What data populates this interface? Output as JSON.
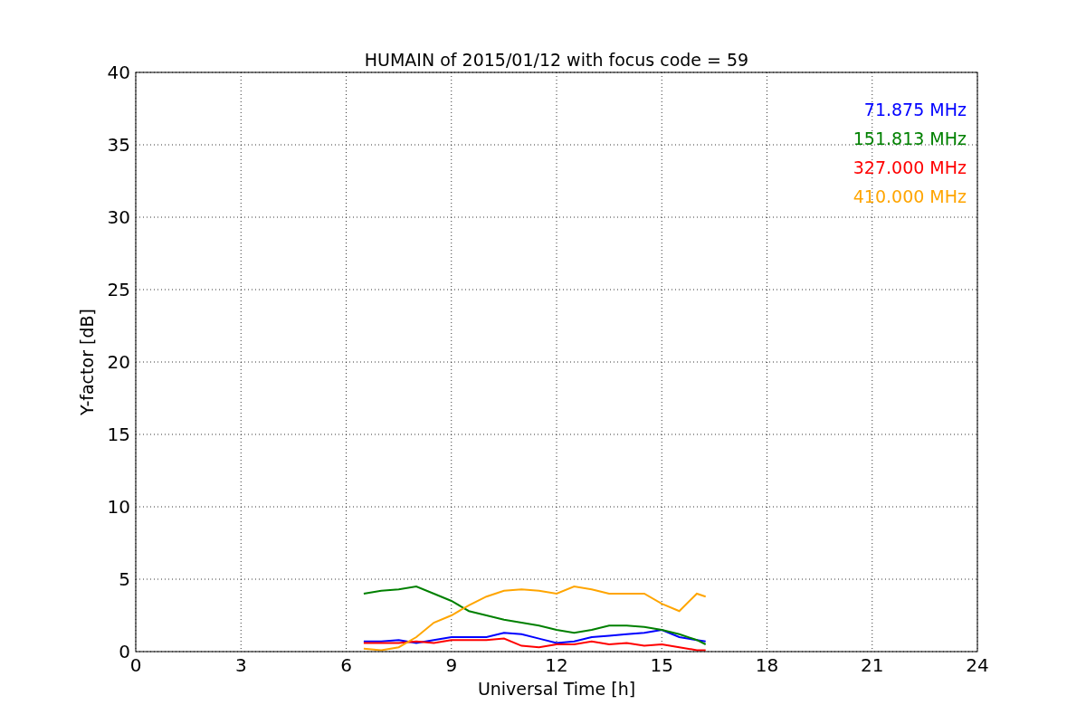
{
  "chart": {
    "chart_data": {
      "type": "line",
      "title": "HUMAIN of 2015/01/12 with focus code = 59",
      "xlabel": "Universal Time [h]",
      "ylabel": "Y-factor [dB]",
      "xlim": [
        0,
        24
      ],
      "ylim": [
        0,
        40
      ],
      "xticks": [
        0,
        3,
        6,
        9,
        12,
        15,
        18,
        21,
        24
      ],
      "yticks": [
        0,
        5,
        10,
        15,
        20,
        25,
        30,
        35,
        40
      ],
      "grid": true,
      "x": [
        6.5,
        7,
        7.5,
        8,
        8.5,
        9,
        9.5,
        10,
        10.5,
        11,
        11.5,
        12,
        12.5,
        13,
        13.5,
        14,
        14.5,
        15,
        15.5,
        16,
        16.25
      ],
      "series": [
        {
          "name": "71.875 MHz",
          "color": "#0000ff",
          "values": [
            0.7,
            0.7,
            0.8,
            0.6,
            0.8,
            1,
            1,
            1,
            1.3,
            1.2,
            0.9,
            0.6,
            0.7,
            1,
            1.1,
            1.2,
            1.3,
            1.5,
            1,
            0.8,
            0.7
          ]
        },
        {
          "name": "151.813 MHz",
          "color": "#008000",
          "values": [
            4,
            4.2,
            4.3,
            4.5,
            4,
            3.5,
            2.8,
            2.5,
            2.2,
            2,
            1.8,
            1.5,
            1.3,
            1.5,
            1.8,
            1.8,
            1.7,
            1.5,
            1.2,
            0.8,
            0.5
          ]
        },
        {
          "name": "327.000 MHz",
          "color": "#ff0000",
          "values": [
            0.6,
            0.6,
            0.6,
            0.7,
            0.6,
            0.8,
            0.8,
            0.8,
            0.9,
            0.4,
            0.3,
            0.5,
            0.5,
            0.7,
            0.5,
            0.6,
            0.4,
            0.5,
            0.3,
            0.1,
            0.1
          ]
        },
        {
          "name": "410.000 MHz",
          "color": "#ffa500",
          "values": [
            0.2,
            0.1,
            0.3,
            1,
            2,
            2.5,
            3.2,
            3.8,
            4.2,
            4.3,
            4.2,
            4,
            4.5,
            4.3,
            4,
            4,
            4,
            3.3,
            2.8,
            4,
            3.8
          ]
        }
      ]
    }
  }
}
